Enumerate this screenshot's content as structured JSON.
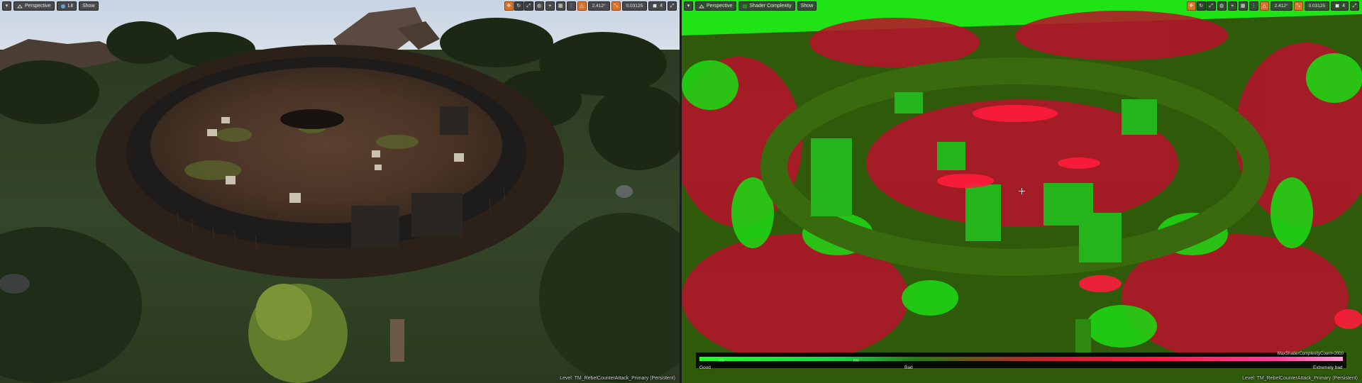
{
  "left_viewport": {
    "menu_icon": "chevron-down-icon",
    "view_mode": "Perspective",
    "lighting_mode": "Lit",
    "show_label": "Show",
    "level_label": "Level:  TM_RebelCounterAttack_Primary (Persistent)"
  },
  "right_viewport": {
    "menu_icon": "chevron-down-icon",
    "view_mode": "Perspective",
    "lighting_mode": "Shader Complexity",
    "show_label": "Show",
    "level_label": "Level:  TM_RebelCounterAttack_Primary (Persistent)"
  },
  "transform_toolbar": {
    "rotation_snap": "2.412°",
    "scale_snap": "0.03125",
    "camera_speed": "4",
    "icons": [
      "translate-icon",
      "rotate-icon",
      "scale-icon",
      "world-local-icon",
      "surface-snap-icon",
      "grid-snap-icon",
      "grid-size-icon",
      "rotation-snap-icon",
      "scale-snap-icon",
      "camera-speed-icon",
      "maximize-icon"
    ]
  },
  "complexity_legend": {
    "max_label": "MaxShaderComplexityCount=2000",
    "good_label": "Good",
    "bad_label": "Bad",
    "extreme_label": "Extremely bad",
    "tick_1": "ms",
    "tick_2": "ms"
  },
  "colors": {
    "accent_orange": "#f08a1c",
    "complexity_good": "#22ff2a",
    "complexity_bad": "#c8222e",
    "complexity_extreme": "#ff9fd6"
  }
}
